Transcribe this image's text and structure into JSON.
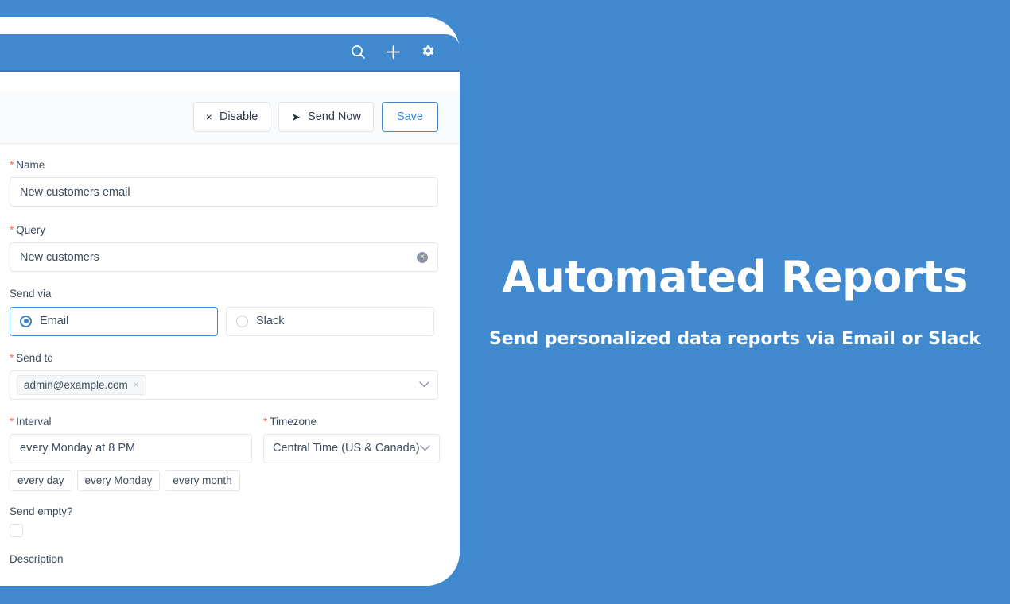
{
  "promo": {
    "title": "Automated Reports",
    "subtitle": "Send personalized data reports via Email or Slack"
  },
  "colors": {
    "brand_blue": "#4189ce",
    "header_border": "#3577b8",
    "link_blue": "#3b8ad9",
    "required_red": "#f5675c",
    "text": "#3d4a5c",
    "toolbar_bg": "#fafbfc"
  },
  "app_header": {
    "icons": [
      {
        "name": "search-icon",
        "label": "Search"
      },
      {
        "name": "plus-icon",
        "label": "Add"
      },
      {
        "name": "gear-icon",
        "label": "Settings"
      }
    ]
  },
  "toolbar": {
    "disable_label": "Disable",
    "disable_glyph": "×",
    "send_now_label": "Send Now",
    "send_now_glyph": "➤",
    "save_label": "Save"
  },
  "form": {
    "name": {
      "label": "Name",
      "required": true,
      "value": "New customers email"
    },
    "query": {
      "label": "Query",
      "required": true,
      "value": "New customers",
      "clear_glyph": "×"
    },
    "send_via": {
      "label": "Send via",
      "required": false,
      "selected": "Email",
      "options": [
        {
          "label": "Email",
          "selected": true
        },
        {
          "label": "Slack",
          "selected": false
        }
      ]
    },
    "send_to": {
      "label": "Send to",
      "required": true,
      "tags": [
        "admin@example.com"
      ],
      "tag_remove_glyph": "×"
    },
    "interval": {
      "label": "Interval",
      "required": true,
      "value": "every Monday at 8 PM",
      "quick_options": [
        "every day",
        "every Monday",
        "every month"
      ]
    },
    "timezone": {
      "label": "Timezone",
      "required": true,
      "value": "Central Time (US & Canada)"
    },
    "send_empty": {
      "label": "Send empty?",
      "checked": false
    },
    "description": {
      "label": "Description"
    }
  }
}
